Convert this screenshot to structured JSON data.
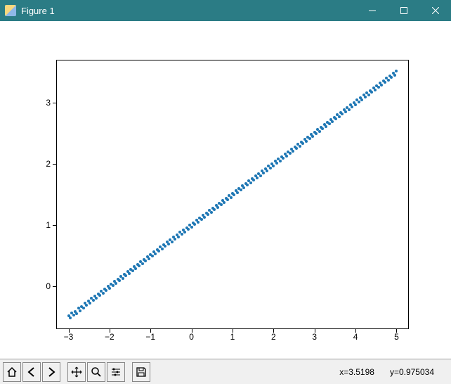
{
  "window": {
    "title": "Figure 1"
  },
  "toolbar": {
    "buttons": [
      {
        "name": "home-icon"
      },
      {
        "name": "back-icon"
      },
      {
        "name": "forward-icon"
      },
      {
        "name": "pan-icon"
      },
      {
        "name": "zoom-icon"
      },
      {
        "name": "configure-icon"
      },
      {
        "name": "save-icon"
      }
    ]
  },
  "status": {
    "x_label": "x=3.5198",
    "y_label": "y=0.975034"
  },
  "chart_data": {
    "type": "scatter",
    "title": "",
    "xlabel": "",
    "ylabel": "",
    "xlim": [
      -3.3,
      5.3
    ],
    "ylim": [
      -0.7,
      3.7
    ],
    "xticks": [
      -3,
      -2,
      -1,
      0,
      1,
      2,
      3,
      4,
      5
    ],
    "yticks": [
      0,
      1,
      2,
      3
    ],
    "note": "scatter of ~200 points lying near a straight line y ≈ 0.5x + 1 with small noise (σ≈0.05)",
    "approx_fit": {
      "slope": 0.5,
      "intercept": 1.0,
      "noise_sigma": 0.05
    },
    "x": [
      -3.0,
      -2.96,
      -2.92,
      -2.88,
      -2.84,
      -2.8,
      -2.76,
      -2.72,
      -2.68,
      -2.64,
      -2.6,
      -2.56,
      -2.52,
      -2.48,
      -2.44,
      -2.4,
      -2.36,
      -2.32,
      -2.28,
      -2.24,
      -2.2,
      -2.16,
      -2.12,
      -2.08,
      -2.04,
      -2.0,
      -1.96,
      -1.92,
      -1.88,
      -1.84,
      -1.8,
      -1.76,
      -1.72,
      -1.68,
      -1.64,
      -1.6,
      -1.56,
      -1.52,
      -1.48,
      -1.44,
      -1.4,
      -1.36,
      -1.32,
      -1.28,
      -1.24,
      -1.2,
      -1.16,
      -1.12,
      -1.08,
      -1.04,
      -1.0,
      -0.96,
      -0.92,
      -0.88,
      -0.84,
      -0.8,
      -0.76,
      -0.72,
      -0.68,
      -0.64,
      -0.6,
      -0.56,
      -0.52,
      -0.48,
      -0.44,
      -0.4,
      -0.36,
      -0.32,
      -0.28,
      -0.24,
      -0.2,
      -0.16,
      -0.12,
      -0.08,
      -0.04,
      0.0,
      0.04,
      0.08,
      0.12,
      0.16,
      0.2,
      0.24,
      0.28,
      0.32,
      0.36,
      0.4,
      0.44,
      0.48,
      0.52,
      0.56,
      0.6,
      0.64,
      0.68,
      0.72,
      0.76,
      0.8,
      0.84,
      0.88,
      0.92,
      0.96,
      1.0,
      1.04,
      1.08,
      1.12,
      1.16,
      1.2,
      1.24,
      1.28,
      1.32,
      1.36,
      1.4,
      1.44,
      1.48,
      1.52,
      1.56,
      1.6,
      1.64,
      1.68,
      1.72,
      1.76,
      1.8,
      1.84,
      1.88,
      1.92,
      1.96,
      2.0,
      2.04,
      2.08,
      2.12,
      2.16,
      2.2,
      2.24,
      2.28,
      2.32,
      2.36,
      2.4,
      2.44,
      2.48,
      2.52,
      2.56,
      2.6,
      2.64,
      2.68,
      2.72,
      2.76,
      2.8,
      2.84,
      2.88,
      2.92,
      2.96,
      3.0,
      3.04,
      3.08,
      3.12,
      3.16,
      3.2,
      3.24,
      3.28,
      3.32,
      3.36,
      3.4,
      3.44,
      3.48,
      3.52,
      3.56,
      3.6,
      3.64,
      3.68,
      3.72,
      3.76,
      3.8,
      3.84,
      3.88,
      3.92,
      3.96,
      4.0,
      4.04,
      4.08,
      4.12,
      4.16,
      4.2,
      4.24,
      4.28,
      4.32,
      4.36,
      4.4,
      4.44,
      4.48,
      4.52,
      4.56,
      4.6,
      4.64,
      4.68,
      4.72,
      4.76,
      4.8,
      4.84,
      4.88,
      4.92,
      4.96,
      5.0
    ],
    "y": [
      -0.48,
      -0.52,
      -0.44,
      -0.47,
      -0.41,
      -0.45,
      -0.36,
      -0.4,
      -0.33,
      -0.35,
      -0.28,
      -0.31,
      -0.24,
      -0.27,
      -0.2,
      -0.23,
      -0.16,
      -0.19,
      -0.12,
      -0.15,
      -0.08,
      -0.11,
      -0.04,
      -0.07,
      0.0,
      -0.03,
      0.04,
      0.01,
      0.08,
      0.05,
      0.12,
      0.09,
      0.16,
      0.13,
      0.2,
      0.17,
      0.24,
      0.21,
      0.28,
      0.25,
      0.32,
      0.29,
      0.36,
      0.33,
      0.4,
      0.37,
      0.44,
      0.41,
      0.48,
      0.45,
      0.52,
      0.49,
      0.56,
      0.53,
      0.6,
      0.57,
      0.64,
      0.61,
      0.68,
      0.65,
      0.72,
      0.69,
      0.76,
      0.73,
      0.8,
      0.77,
      0.84,
      0.81,
      0.88,
      0.85,
      0.92,
      0.89,
      0.96,
      0.93,
      1.0,
      0.97,
      1.04,
      1.01,
      1.08,
      1.05,
      1.12,
      1.09,
      1.16,
      1.13,
      1.2,
      1.17,
      1.24,
      1.21,
      1.28,
      1.25,
      1.32,
      1.29,
      1.36,
      1.33,
      1.4,
      1.37,
      1.44,
      1.41,
      1.48,
      1.45,
      1.52,
      1.49,
      1.56,
      1.53,
      1.6,
      1.57,
      1.64,
      1.61,
      1.68,
      1.65,
      1.72,
      1.69,
      1.76,
      1.73,
      1.8,
      1.77,
      1.84,
      1.81,
      1.88,
      1.85,
      1.92,
      1.89,
      1.96,
      1.93,
      2.0,
      1.97,
      2.04,
      2.01,
      2.08,
      2.05,
      2.12,
      2.09,
      2.16,
      2.13,
      2.2,
      2.17,
      2.24,
      2.21,
      2.28,
      2.25,
      2.32,
      2.29,
      2.36,
      2.33,
      2.4,
      2.37,
      2.44,
      2.41,
      2.48,
      2.45,
      2.52,
      2.49,
      2.56,
      2.53,
      2.6,
      2.57,
      2.64,
      2.61,
      2.68,
      2.65,
      2.72,
      2.69,
      2.76,
      2.73,
      2.8,
      2.77,
      2.84,
      2.81,
      2.88,
      2.85,
      2.92,
      2.89,
      2.96,
      2.93,
      3.0,
      2.97,
      3.04,
      3.01,
      3.08,
      3.05,
      3.12,
      3.09,
      3.16,
      3.13,
      3.2,
      3.17,
      3.24,
      3.21,
      3.28,
      3.25,
      3.32,
      3.29,
      3.36,
      3.33,
      3.4,
      3.37,
      3.44,
      3.41,
      3.48,
      3.45,
      3.52,
      3.49
    ]
  }
}
